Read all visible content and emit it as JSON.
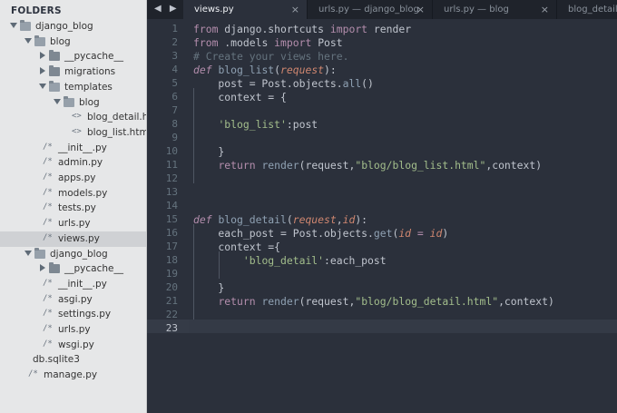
{
  "sidebar": {
    "title": "FOLDERS",
    "items": [
      {
        "label": "django_blog",
        "kind": "folder",
        "state": "open",
        "depth": 0
      },
      {
        "label": "blog",
        "kind": "folder",
        "state": "open",
        "depth": 1
      },
      {
        "label": "__pycache__",
        "kind": "folder",
        "state": "closed",
        "depth": 2
      },
      {
        "label": "migrations",
        "kind": "folder",
        "state": "closed",
        "depth": 2
      },
      {
        "label": "templates",
        "kind": "folder",
        "state": "open",
        "depth": 2
      },
      {
        "label": "blog",
        "kind": "folder",
        "state": "open",
        "depth": 3
      },
      {
        "label": "blog_detail.html",
        "kind": "html",
        "depth": 4
      },
      {
        "label": "blog_list.html",
        "kind": "html",
        "depth": 4
      },
      {
        "label": "__init__.py",
        "kind": "py",
        "depth": 2
      },
      {
        "label": "admin.py",
        "kind": "py",
        "depth": 2
      },
      {
        "label": "apps.py",
        "kind": "py",
        "depth": 2
      },
      {
        "label": "models.py",
        "kind": "py",
        "depth": 2
      },
      {
        "label": "tests.py",
        "kind": "py",
        "depth": 2
      },
      {
        "label": "urls.py",
        "kind": "py",
        "depth": 2
      },
      {
        "label": "views.py",
        "kind": "py",
        "depth": 2,
        "selected": true
      },
      {
        "label": "django_blog",
        "kind": "folder",
        "state": "open",
        "depth": 1
      },
      {
        "label": "__pycache__",
        "kind": "folder",
        "state": "closed",
        "depth": 2
      },
      {
        "label": "__init__.py",
        "kind": "py",
        "depth": 2
      },
      {
        "label": "asgi.py",
        "kind": "py",
        "depth": 2
      },
      {
        "label": "settings.py",
        "kind": "py",
        "depth": 2
      },
      {
        "label": "urls.py",
        "kind": "py",
        "depth": 2
      },
      {
        "label": "wsgi.py",
        "kind": "py",
        "depth": 2
      },
      {
        "label": "db.sqlite3",
        "kind": "file",
        "depth": 1
      },
      {
        "label": "manage.py",
        "kind": "py",
        "depth": 1
      }
    ]
  },
  "tabs": {
    "nav": "◀ ▶",
    "items": [
      {
        "label": "views.py",
        "active": true,
        "close": "×"
      },
      {
        "label": "urls.py — django_blog",
        "active": false,
        "close": "×"
      },
      {
        "label": "urls.py — blog",
        "active": false,
        "close": "×"
      },
      {
        "label": "blog_detail.html",
        "active": false,
        "close": ""
      }
    ]
  },
  "editor": {
    "current_line": 23,
    "lines": [
      {
        "n": "1",
        "tokens": [
          [
            "kw",
            "from "
          ],
          [
            "op",
            "django.shortcuts "
          ],
          [
            "kw",
            "import "
          ],
          [
            "op",
            "render"
          ]
        ]
      },
      {
        "n": "2",
        "tokens": [
          [
            "kw",
            "from "
          ],
          [
            "op",
            ".models "
          ],
          [
            "kw",
            "import "
          ],
          [
            "op",
            "Post"
          ]
        ]
      },
      {
        "n": "3",
        "tokens": [
          [
            "cm",
            "# Create your views here."
          ]
        ]
      },
      {
        "n": "4",
        "tokens": [
          [
            "kwi",
            "def "
          ],
          [
            "defn",
            "blog_list"
          ],
          [
            "op",
            "("
          ],
          [
            "prm",
            "request"
          ],
          [
            "op",
            "):"
          ]
        ]
      },
      {
        "n": "5",
        "tokens": [
          [
            "op",
            "    post = Post.objects."
          ],
          [
            "fn",
            "all"
          ],
          [
            "op",
            "()"
          ]
        ]
      },
      {
        "n": "6",
        "tokens": [
          [
            "op",
            "    context = {"
          ]
        ]
      },
      {
        "n": "7",
        "tokens": []
      },
      {
        "n": "8",
        "tokens": [
          [
            "op",
            "    "
          ],
          [
            "str",
            "'blog_list'"
          ],
          [
            "op",
            ":post"
          ]
        ]
      },
      {
        "n": "9",
        "tokens": []
      },
      {
        "n": "10",
        "tokens": [
          [
            "op",
            "    }"
          ]
        ]
      },
      {
        "n": "11",
        "tokens": [
          [
            "op",
            "    "
          ],
          [
            "kw",
            "return "
          ],
          [
            "fn",
            "render"
          ],
          [
            "op",
            "(request,"
          ],
          [
            "str",
            "\"blog/blog_list.html\""
          ],
          [
            "op",
            ",context)"
          ]
        ]
      },
      {
        "n": "12",
        "tokens": []
      },
      {
        "n": "13",
        "tokens": []
      },
      {
        "n": "14",
        "tokens": []
      },
      {
        "n": "15",
        "tokens": [
          [
            "kwi",
            "def "
          ],
          [
            "defn",
            "blog_detail"
          ],
          [
            "op",
            "("
          ],
          [
            "prm",
            "request"
          ],
          [
            "op",
            ","
          ],
          [
            "prm",
            "id"
          ],
          [
            "op",
            "):"
          ]
        ]
      },
      {
        "n": "16",
        "tokens": [
          [
            "op",
            "    each_post = Post.objects."
          ],
          [
            "fn",
            "get"
          ],
          [
            "op",
            "("
          ],
          [
            "prm",
            "id"
          ],
          [
            "op",
            " "
          ],
          [
            "kw",
            "="
          ],
          [
            "op",
            " "
          ],
          [
            "prm",
            "id"
          ],
          [
            "op",
            ")"
          ]
        ]
      },
      {
        "n": "17",
        "tokens": [
          [
            "op",
            "    context ={"
          ]
        ]
      },
      {
        "n": "18",
        "tokens": [
          [
            "op",
            "        "
          ],
          [
            "str",
            "'blog_detail'"
          ],
          [
            "op",
            ":each_post"
          ]
        ]
      },
      {
        "n": "19",
        "tokens": []
      },
      {
        "n": "20",
        "tokens": [
          [
            "op",
            "    }"
          ]
        ]
      },
      {
        "n": "21",
        "tokens": [
          [
            "op",
            "    "
          ],
          [
            "kw",
            "return "
          ],
          [
            "fn",
            "render"
          ],
          [
            "op",
            "(request,"
          ],
          [
            "str",
            "\"blog/blog_detail.html\""
          ],
          [
            "op",
            ",context)"
          ]
        ]
      },
      {
        "n": "22",
        "tokens": []
      },
      {
        "n": "23",
        "tokens": []
      }
    ]
  },
  "colors": {
    "editor_bg": "#2b303b",
    "sidebar_bg": "#e6e7e8",
    "keyword": "#b48ead",
    "string": "#a3be8c",
    "function": "#8fa1b3",
    "comment": "#65737e",
    "param": "#d08770"
  }
}
